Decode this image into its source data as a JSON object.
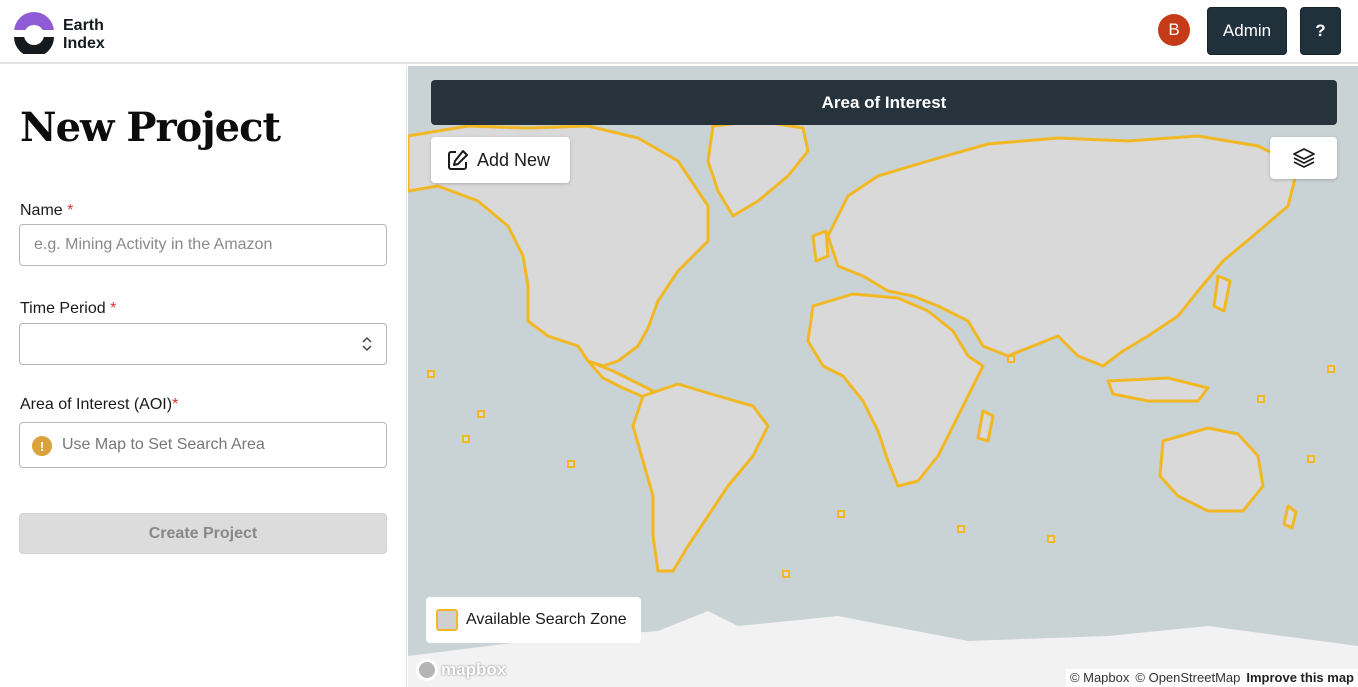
{
  "header": {
    "logo_line1": "Earth",
    "logo_line2": "Index",
    "avatar_initial": "B",
    "admin_label": "Admin",
    "help_label": "?",
    "logo_colors": {
      "purple": "#8f5bd6",
      "dark": "#151a1f"
    },
    "avatar_color": "#c63b17"
  },
  "form": {
    "title": "New Project",
    "name_label": "Name",
    "name_placeholder": "e.g. Mining Activity in the Amazon",
    "name_value": "",
    "time_label": "Time Period",
    "time_value": "",
    "aoi_label": "Area of Interest (AOI)",
    "aoi_text": "Use Map to Set Search Area",
    "required_marker": "*",
    "create_label": "Create Project",
    "warn_icon": "!"
  },
  "map": {
    "bar_title": "Area of Interest",
    "add_new_label": "Add New",
    "legend_label": "Available Search Zone",
    "mapbox_label": "mapbox",
    "attrib_mapbox": "© Mapbox",
    "attrib_osm": "© OpenStreetMap",
    "attrib_improve": "Improve this map",
    "colors": {
      "water": "#c9d2d4",
      "land": "#d9d9d9",
      "zone": "#f2b824",
      "ice": "#f2f2f2"
    }
  }
}
